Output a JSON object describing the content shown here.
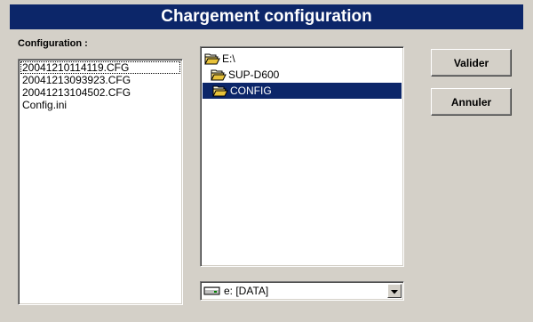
{
  "window": {
    "title": "Chargement configuration"
  },
  "config_panel": {
    "label": "Configuration :",
    "files": [
      "20041210114119.CFG",
      "20041213093923.CFG",
      "20041213104502.CFG",
      "Config.ini"
    ]
  },
  "directory_tree": {
    "items": [
      {
        "label": "E:\\",
        "icon": "open-folder-icon"
      },
      {
        "label": "SUP-D600",
        "icon": "open-folder-icon"
      },
      {
        "label": "CONFIG",
        "icon": "open-folder-icon",
        "selected": true
      }
    ]
  },
  "drive_select": {
    "value": "e: [DATA]",
    "icon": "drive-icon"
  },
  "buttons": {
    "ok_label": "Valider",
    "cancel_label": "Annuler"
  },
  "colors": {
    "title_bar": "#0c2669",
    "selection": "#0c2669",
    "background": "#d4d0c8"
  }
}
